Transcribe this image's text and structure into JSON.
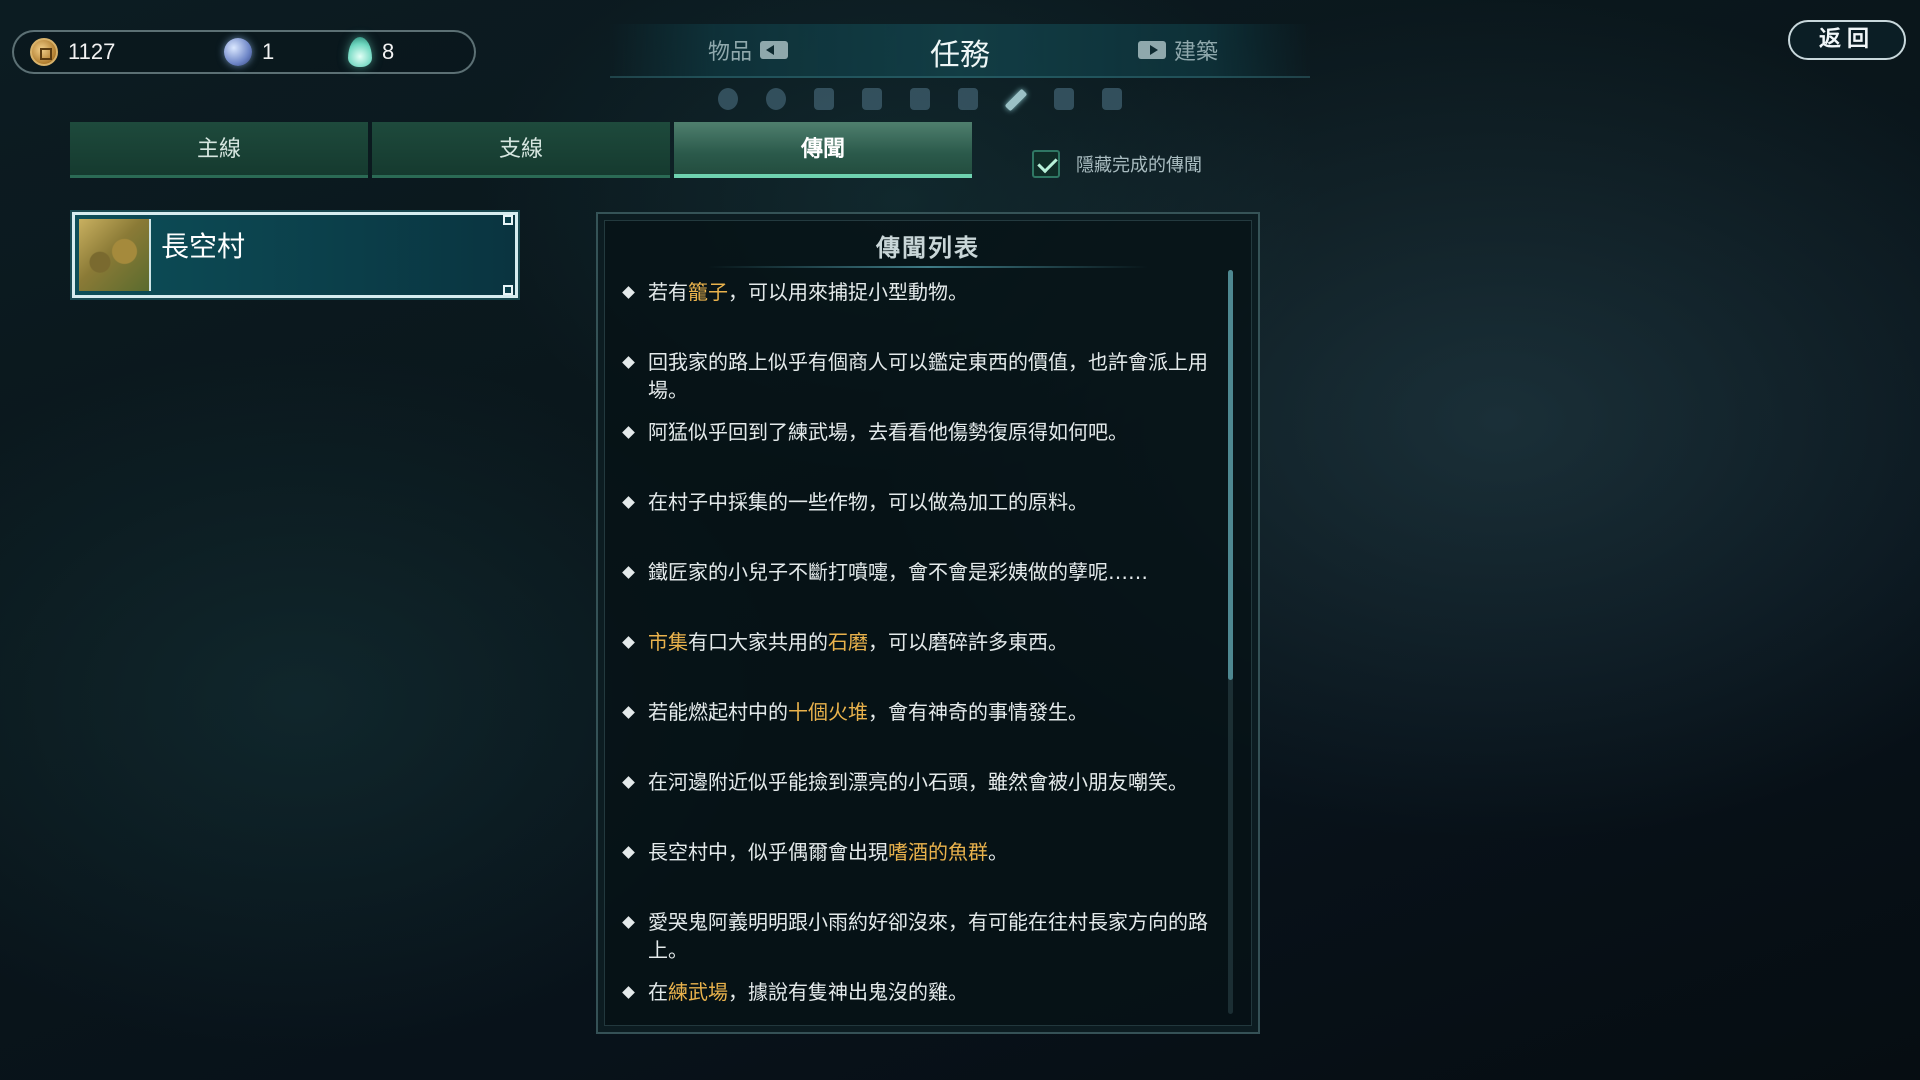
{
  "currency": {
    "gold": "1127",
    "jade": "1",
    "spirit": "8"
  },
  "top_tabs": {
    "items_label": "物品",
    "quests_label": "任務",
    "buildings_label": "建築"
  },
  "back_label": "返回",
  "quest_tabs": [
    "主線",
    "支線",
    "傳聞"
  ],
  "hide_completed_label": "隱藏完成的傳聞",
  "location": {
    "name": "長空村"
  },
  "rumor_panel": {
    "title": "傳聞列表",
    "items": [
      {
        "parts": [
          "若有",
          "籠子",
          "，可以用來捕捉小型動物。"
        ]
      },
      {
        "parts": [
          "回我家的路上似乎有個商人可以鑑定東西的價值，也許會派上用場。"
        ]
      },
      {
        "parts": [
          "阿猛似乎回到了練武場，去看看他傷勢復原得如何吧。"
        ]
      },
      {
        "parts": [
          "在村子中採集的一些作物，可以做為加工的原料。"
        ]
      },
      {
        "parts": [
          "鐵匠家的小兒子不斷打噴嚏，會不會是彩姨做的孽呢……"
        ]
      },
      {
        "parts": [
          "",
          "市集",
          "有口大家共用的",
          "石磨",
          "，可以磨碎許多東西。"
        ]
      },
      {
        "parts": [
          "若能燃起村中的",
          "十個火堆",
          "，會有神奇的事情發生。"
        ]
      },
      {
        "parts": [
          "在河邊附近似乎能撿到漂亮的小石頭，雖然會被小朋友嘲笑。"
        ]
      },
      {
        "parts": [
          "長空村中，似乎偶爾會出現",
          "嗜酒的魚群",
          "。"
        ]
      },
      {
        "parts": [
          "愛哭鬼阿義明明跟小雨約好卻沒來，有可能在往村長家方向的路上。"
        ]
      },
      {
        "parts": [
          "在",
          "練武場",
          "，據說有隻神出鬼沒的雞。"
        ]
      }
    ]
  },
  "colors": {
    "highlight": "#e9b24c",
    "accent": "#6fd2b0"
  }
}
